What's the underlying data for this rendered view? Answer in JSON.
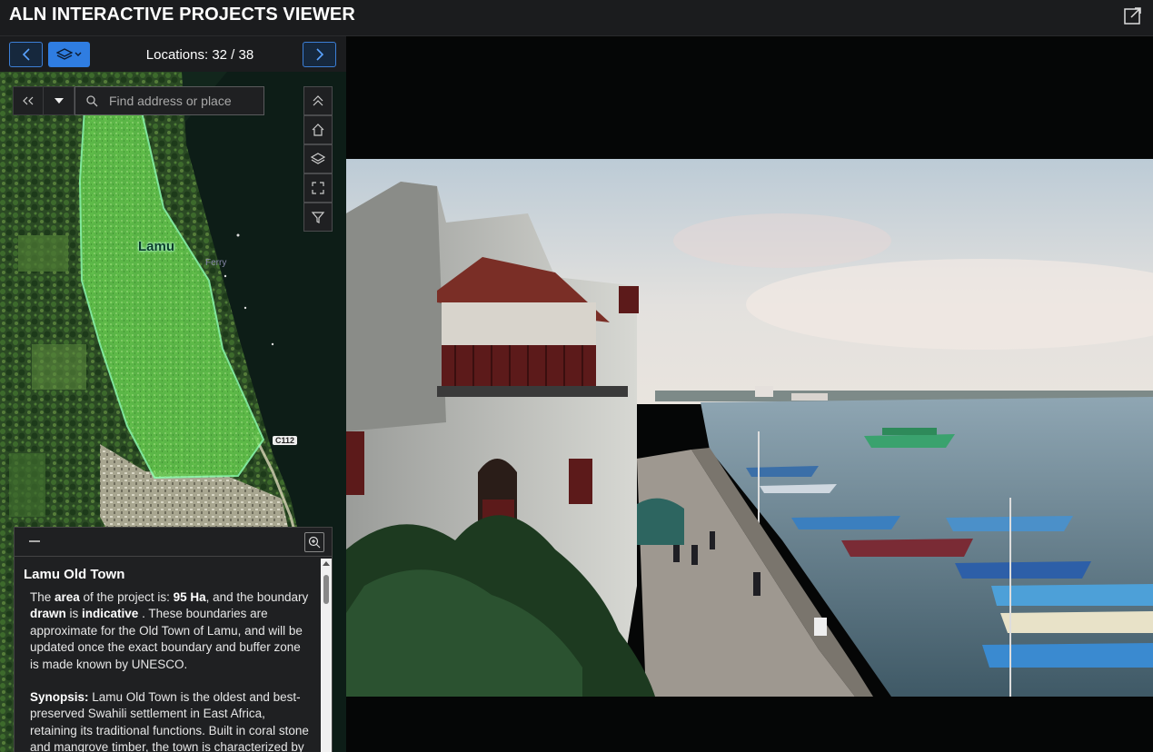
{
  "app": {
    "title": "ALN INTERACTIVE PROJECTS VIEWER",
    "share_icon": "share-icon"
  },
  "nav": {
    "prev_icon": "chevron-left-icon",
    "layers_icon": "layers-icon",
    "next_icon": "chevron-right-icon",
    "locations": "Locations: 32 / 38"
  },
  "map": {
    "search_placeholder": "Find address or place",
    "labels": {
      "town": "Lamu",
      "ferry": "Ferry",
      "road": "C112"
    },
    "tools": [
      "collapse-up-icon",
      "home-icon",
      "layers-icon",
      "fullscreen-icon",
      "filter-icon"
    ],
    "colors": {
      "boundary": "#7dff9a",
      "boundary_fill": "#6fe35a"
    }
  },
  "info": {
    "title": "Lamu Old Town",
    "p1": {
      "t1": "The ",
      "b1": "area",
      "t2": " of the project is: ",
      "b2": "95 Ha",
      "t3": ", and the boundary ",
      "b3": "drawn",
      "t4": " is ",
      "b4": "indicative",
      "t5": " . These boundaries are approximate for the Old Town of Lamu, and will be updated once the exact boundary and buffer zone is made known by UNESCO."
    },
    "p2": {
      "b1": "Synopsis:",
      "t1": " Lamu Old Town is the oldest and best-preserved Swahili settlement in East Africa, retaining its traditional functions. Built in coral stone and mangrove timber, the town is characterized by the simplicity of structural"
    }
  }
}
